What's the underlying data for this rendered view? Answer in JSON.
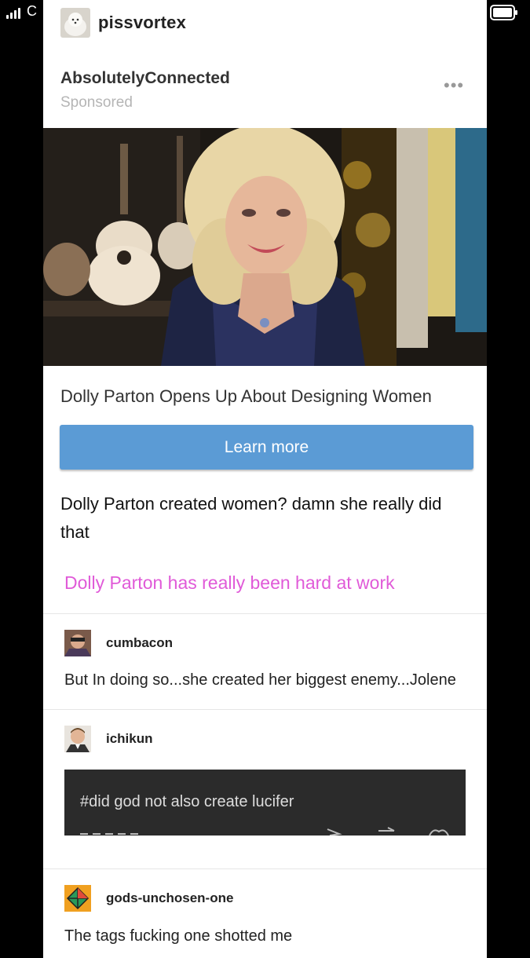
{
  "status": {
    "carrier": "C"
  },
  "post": {
    "blog_name": "pissvortex",
    "sponsor": "AbsolutelyConnected",
    "sponsored_label": "Sponsored",
    "more_label": "•••",
    "ad_headline": "Dolly Parton Opens Up About Designing Women",
    "cta_label": "Learn more",
    "body_text": "Dolly Parton created women? damn she really did that",
    "pink_text": "Dolly Parton has really been hard at work"
  },
  "reblogs": [
    {
      "username": "cumbacon",
      "text": "But In doing so...she created her biggest enemy...Jolene"
    },
    {
      "username": "ichikun",
      "embedded_tag": "#did god not also create lucifer"
    },
    {
      "username": "gods-unchosen-one",
      "text": "The tags fucking one shotted me"
    }
  ],
  "colors": {
    "cta": "#5b9bd5",
    "pink": "#e05ad8",
    "sponsored": "#b5b5b5"
  }
}
